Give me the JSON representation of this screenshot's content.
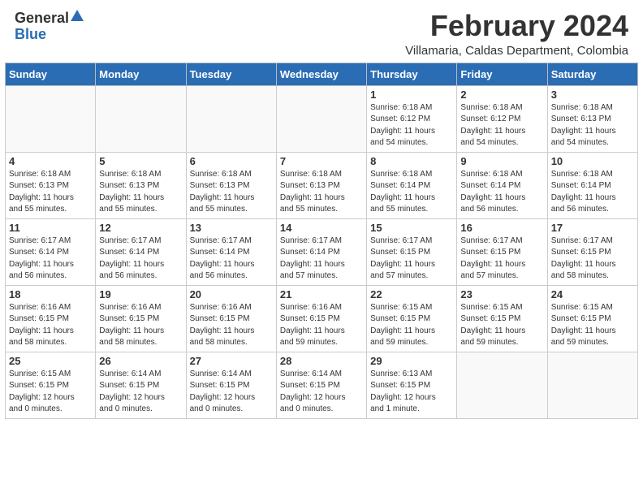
{
  "header": {
    "logo_general": "General",
    "logo_blue": "Blue",
    "title": "February 2024",
    "location": "Villamaria, Caldas Department, Colombia"
  },
  "days_of_week": [
    "Sunday",
    "Monday",
    "Tuesday",
    "Wednesday",
    "Thursday",
    "Friday",
    "Saturday"
  ],
  "weeks": [
    [
      {
        "day": "",
        "info": ""
      },
      {
        "day": "",
        "info": ""
      },
      {
        "day": "",
        "info": ""
      },
      {
        "day": "",
        "info": ""
      },
      {
        "day": "1",
        "info": "Sunrise: 6:18 AM\nSunset: 6:12 PM\nDaylight: 11 hours\nand 54 minutes."
      },
      {
        "day": "2",
        "info": "Sunrise: 6:18 AM\nSunset: 6:12 PM\nDaylight: 11 hours\nand 54 minutes."
      },
      {
        "day": "3",
        "info": "Sunrise: 6:18 AM\nSunset: 6:13 PM\nDaylight: 11 hours\nand 54 minutes."
      }
    ],
    [
      {
        "day": "4",
        "info": "Sunrise: 6:18 AM\nSunset: 6:13 PM\nDaylight: 11 hours\nand 55 minutes."
      },
      {
        "day": "5",
        "info": "Sunrise: 6:18 AM\nSunset: 6:13 PM\nDaylight: 11 hours\nand 55 minutes."
      },
      {
        "day": "6",
        "info": "Sunrise: 6:18 AM\nSunset: 6:13 PM\nDaylight: 11 hours\nand 55 minutes."
      },
      {
        "day": "7",
        "info": "Sunrise: 6:18 AM\nSunset: 6:13 PM\nDaylight: 11 hours\nand 55 minutes."
      },
      {
        "day": "8",
        "info": "Sunrise: 6:18 AM\nSunset: 6:14 PM\nDaylight: 11 hours\nand 55 minutes."
      },
      {
        "day": "9",
        "info": "Sunrise: 6:18 AM\nSunset: 6:14 PM\nDaylight: 11 hours\nand 56 minutes."
      },
      {
        "day": "10",
        "info": "Sunrise: 6:18 AM\nSunset: 6:14 PM\nDaylight: 11 hours\nand 56 minutes."
      }
    ],
    [
      {
        "day": "11",
        "info": "Sunrise: 6:17 AM\nSunset: 6:14 PM\nDaylight: 11 hours\nand 56 minutes."
      },
      {
        "day": "12",
        "info": "Sunrise: 6:17 AM\nSunset: 6:14 PM\nDaylight: 11 hours\nand 56 minutes."
      },
      {
        "day": "13",
        "info": "Sunrise: 6:17 AM\nSunset: 6:14 PM\nDaylight: 11 hours\nand 56 minutes."
      },
      {
        "day": "14",
        "info": "Sunrise: 6:17 AM\nSunset: 6:14 PM\nDaylight: 11 hours\nand 57 minutes."
      },
      {
        "day": "15",
        "info": "Sunrise: 6:17 AM\nSunset: 6:15 PM\nDaylight: 11 hours\nand 57 minutes."
      },
      {
        "day": "16",
        "info": "Sunrise: 6:17 AM\nSunset: 6:15 PM\nDaylight: 11 hours\nand 57 minutes."
      },
      {
        "day": "17",
        "info": "Sunrise: 6:17 AM\nSunset: 6:15 PM\nDaylight: 11 hours\nand 58 minutes."
      }
    ],
    [
      {
        "day": "18",
        "info": "Sunrise: 6:16 AM\nSunset: 6:15 PM\nDaylight: 11 hours\nand 58 minutes."
      },
      {
        "day": "19",
        "info": "Sunrise: 6:16 AM\nSunset: 6:15 PM\nDaylight: 11 hours\nand 58 minutes."
      },
      {
        "day": "20",
        "info": "Sunrise: 6:16 AM\nSunset: 6:15 PM\nDaylight: 11 hours\nand 58 minutes."
      },
      {
        "day": "21",
        "info": "Sunrise: 6:16 AM\nSunset: 6:15 PM\nDaylight: 11 hours\nand 59 minutes."
      },
      {
        "day": "22",
        "info": "Sunrise: 6:15 AM\nSunset: 6:15 PM\nDaylight: 11 hours\nand 59 minutes."
      },
      {
        "day": "23",
        "info": "Sunrise: 6:15 AM\nSunset: 6:15 PM\nDaylight: 11 hours\nand 59 minutes."
      },
      {
        "day": "24",
        "info": "Sunrise: 6:15 AM\nSunset: 6:15 PM\nDaylight: 11 hours\nand 59 minutes."
      }
    ],
    [
      {
        "day": "25",
        "info": "Sunrise: 6:15 AM\nSunset: 6:15 PM\nDaylight: 12 hours\nand 0 minutes."
      },
      {
        "day": "26",
        "info": "Sunrise: 6:14 AM\nSunset: 6:15 PM\nDaylight: 12 hours\nand 0 minutes."
      },
      {
        "day": "27",
        "info": "Sunrise: 6:14 AM\nSunset: 6:15 PM\nDaylight: 12 hours\nand 0 minutes."
      },
      {
        "day": "28",
        "info": "Sunrise: 6:14 AM\nSunset: 6:15 PM\nDaylight: 12 hours\nand 0 minutes."
      },
      {
        "day": "29",
        "info": "Sunrise: 6:13 AM\nSunset: 6:15 PM\nDaylight: 12 hours\nand 1 minute."
      },
      {
        "day": "",
        "info": ""
      },
      {
        "day": "",
        "info": ""
      }
    ]
  ]
}
